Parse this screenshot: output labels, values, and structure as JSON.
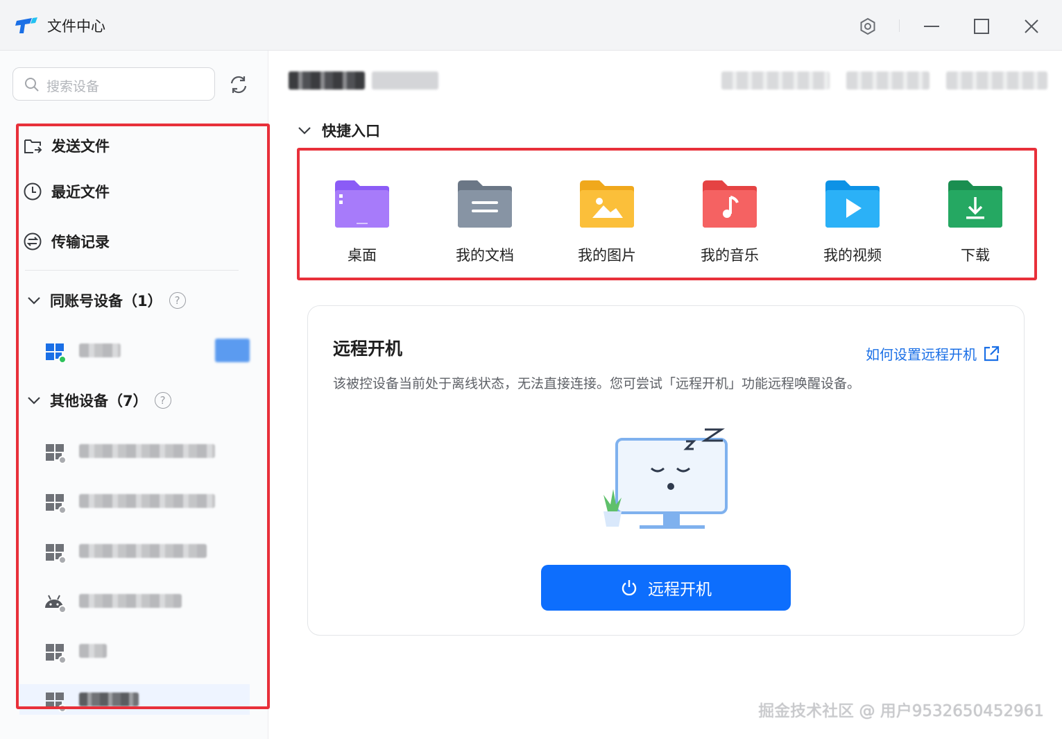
{
  "window": {
    "title": "文件中心",
    "controls": [
      "settings-icon",
      "minimize-icon",
      "maximize-icon",
      "close-icon"
    ]
  },
  "sidebar": {
    "search": {
      "placeholder": "搜索设备"
    },
    "menu": [
      {
        "label": "发送文件",
        "icon": "send-file-icon"
      },
      {
        "label": "最近文件",
        "icon": "clock-icon"
      },
      {
        "label": "传输记录",
        "icon": "transfer-icon"
      }
    ],
    "groups": [
      {
        "label": "同账号设备（1）",
        "devices": [
          {
            "os": "windows",
            "online": true
          }
        ]
      },
      {
        "label": "其他设备（7）",
        "devices": [
          {
            "os": "windows",
            "online": false
          },
          {
            "os": "windows",
            "online": false
          },
          {
            "os": "windows",
            "online": false
          },
          {
            "os": "android",
            "online": false
          },
          {
            "os": "windows",
            "online": false
          },
          {
            "os": "windows",
            "online": false
          }
        ]
      }
    ]
  },
  "main": {
    "quick_access": {
      "title": "快捷入口",
      "items": [
        {
          "label": "桌面",
          "icon": "desktop-folder-icon",
          "color": "#8b5cf6"
        },
        {
          "label": "我的文档",
          "icon": "documents-folder-icon",
          "color": "#7a8797"
        },
        {
          "label": "我的图片",
          "icon": "pictures-folder-icon",
          "color": "#f5b429"
        },
        {
          "label": "我的音乐",
          "icon": "music-folder-icon",
          "color": "#f0504f"
        },
        {
          "label": "我的视频",
          "icon": "videos-folder-icon",
          "color": "#1ea7f5"
        },
        {
          "label": "下载",
          "icon": "downloads-folder-icon",
          "color": "#22a45d"
        }
      ]
    },
    "remote_boot": {
      "title": "远程开机",
      "help_link": "如何设置远程开机",
      "description": "该被控设备当前处于离线状态，无法直接连接。您可尝试「远程开机」功能远程唤醒设备。",
      "button": "远程开机"
    }
  },
  "watermark": "掘金技术社区 @ 用户9532650452961",
  "colors": {
    "accent": "#0d6efd",
    "link": "#1a6fe6",
    "highlight_box": "#e8303a"
  }
}
